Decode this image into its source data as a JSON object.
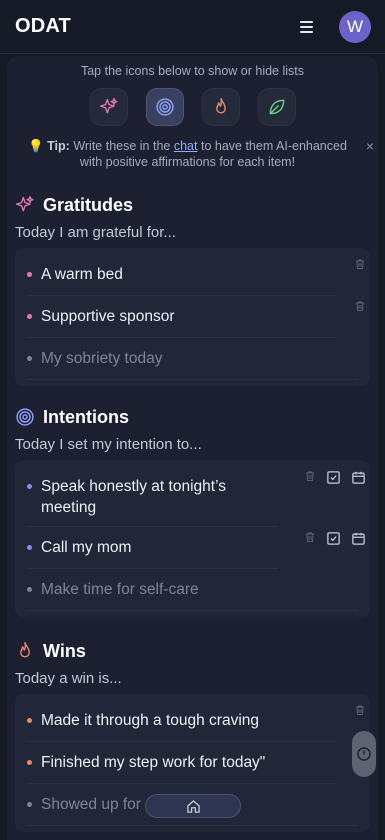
{
  "app": {
    "title": "ODAT",
    "avatar_letter": "W"
  },
  "hint": "Tap the icons below to show or hide lists",
  "toggles": [
    {
      "name": "gratitudes-toggle",
      "icon": "sparkle-icon",
      "active": false
    },
    {
      "name": "intentions-toggle",
      "icon": "target-icon",
      "active": true
    },
    {
      "name": "wins-toggle",
      "icon": "flame-icon",
      "active": false
    },
    {
      "name": "leaf-toggle",
      "icon": "leaf-icon",
      "active": false
    }
  ],
  "tip": {
    "icon": "💡",
    "label": "Tip:",
    "text_before": "Write these in the",
    "link": "chat",
    "text_after": "to have them AI-enhanced with positive affirmations for each item!",
    "close": "×"
  },
  "sections": {
    "gratitudes": {
      "title": "Gratitudes",
      "prompt": "Today I am grateful for...",
      "items": [
        "A warm bed",
        "Supportive sponsor"
      ],
      "placeholder": "My sobriety today"
    },
    "intentions": {
      "title": "Intentions",
      "prompt": "Today I set my intention to...",
      "items": [
        "Speak honestly at tonight’s meeting",
        "Call my mom"
      ],
      "placeholder": "Make time for self-care"
    },
    "wins": {
      "title": "Wins",
      "prompt": "Today a win is...",
      "items": [
        "Made it through a tough craving",
        "Finished my step work for today\""
      ],
      "placeholder": "Showed up for"
    }
  },
  "colors": {
    "gratitudes": "#e07ab0",
    "intentions": "#7f8ff0",
    "wins": "#e88a6a",
    "leaf": "#6fcf8a",
    "accent_avatar": "#6b63c8"
  }
}
